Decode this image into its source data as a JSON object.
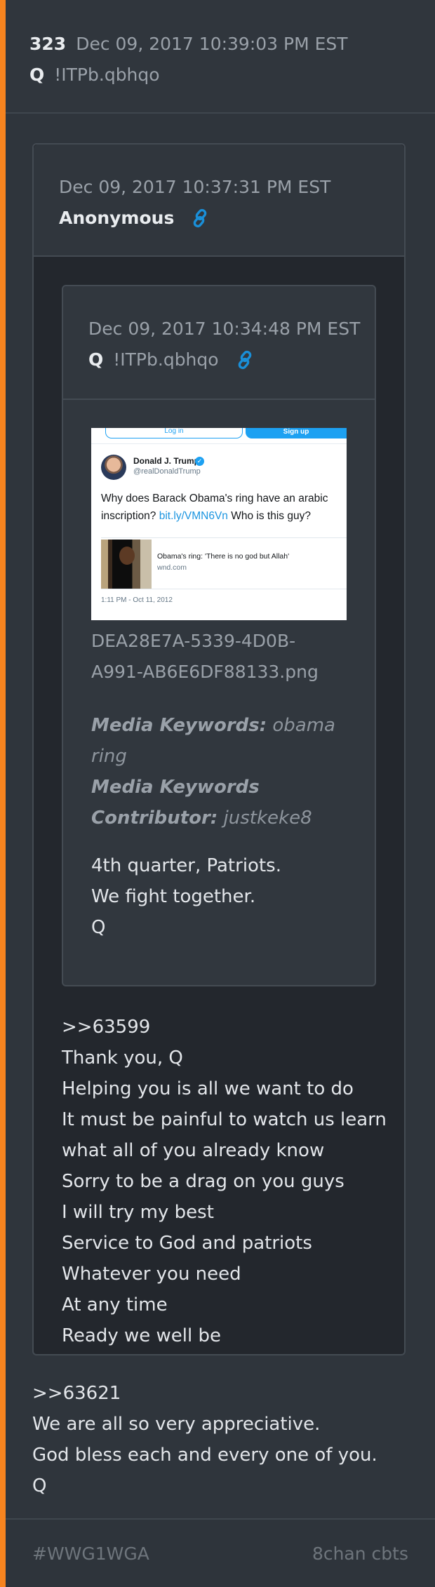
{
  "post": {
    "number": "323",
    "timestamp": "Dec 09, 2017 10:39:03 PM EST",
    "author": "Q",
    "tripcode": "!ITPb.qbhqo"
  },
  "quoted1": {
    "timestamp": "Dec 09, 2017 10:37:31 PM EST",
    "author": "Anonymous",
    "link_icon": "link-icon",
    "reply_lines": [
      ">>63599",
      "Thank you, Q",
      "Helping you is all we want to do",
      "It must be painful to watch us learn",
      "what all of you already know",
      "Sorry to be a drag on you guys",
      "I will try my best",
      "Service to God and patriots",
      "Whatever you need",
      "At any time",
      "Ready we well be"
    ]
  },
  "quoted2": {
    "timestamp": "Dec 09, 2017 10:34:48 PM EST",
    "author": "Q",
    "tripcode": "!ITPb.qbhqo",
    "link_icon": "link-icon",
    "image": {
      "login_label": "Log in",
      "signup_label": "Sign up",
      "tweet_name": "Donald J. Trump",
      "tweet_handle": "@realDonaldTrump",
      "tweet_text_1": "Why does Barack Obama's ring have an arabic inscription? ",
      "tweet_link": "bit.ly/VMN6Vn",
      "tweet_text_2": " Who is this guy?",
      "card_title": "Obama's ring: 'There is no god but Allah'",
      "card_domain": "wnd.com",
      "tweet_time": "1:11 PM - Oct 11, 2012"
    },
    "filename": "DEA28E7A-5339-4D0B-A991-AB6E6DF88133.png",
    "media_keywords_label": "Media Keywords:",
    "media_keywords": "obama ring",
    "contributor_label": "Media Keywords Contributor:",
    "contributor": "justkeke8",
    "message_lines": [
      "4th quarter, Patriots.",
      "We fight together.",
      "Q"
    ]
  },
  "reply_lines": [
    ">>63621",
    "We are all so very appreciative.",
    "God bless each and every one of you.",
    "Q"
  ],
  "footer": {
    "hashtag": "#WWG1WGA",
    "source": "8chan cbts"
  },
  "colors": {
    "accent": "#f7841f",
    "link": "#1a8fd8",
    "background": "#2f353c"
  }
}
